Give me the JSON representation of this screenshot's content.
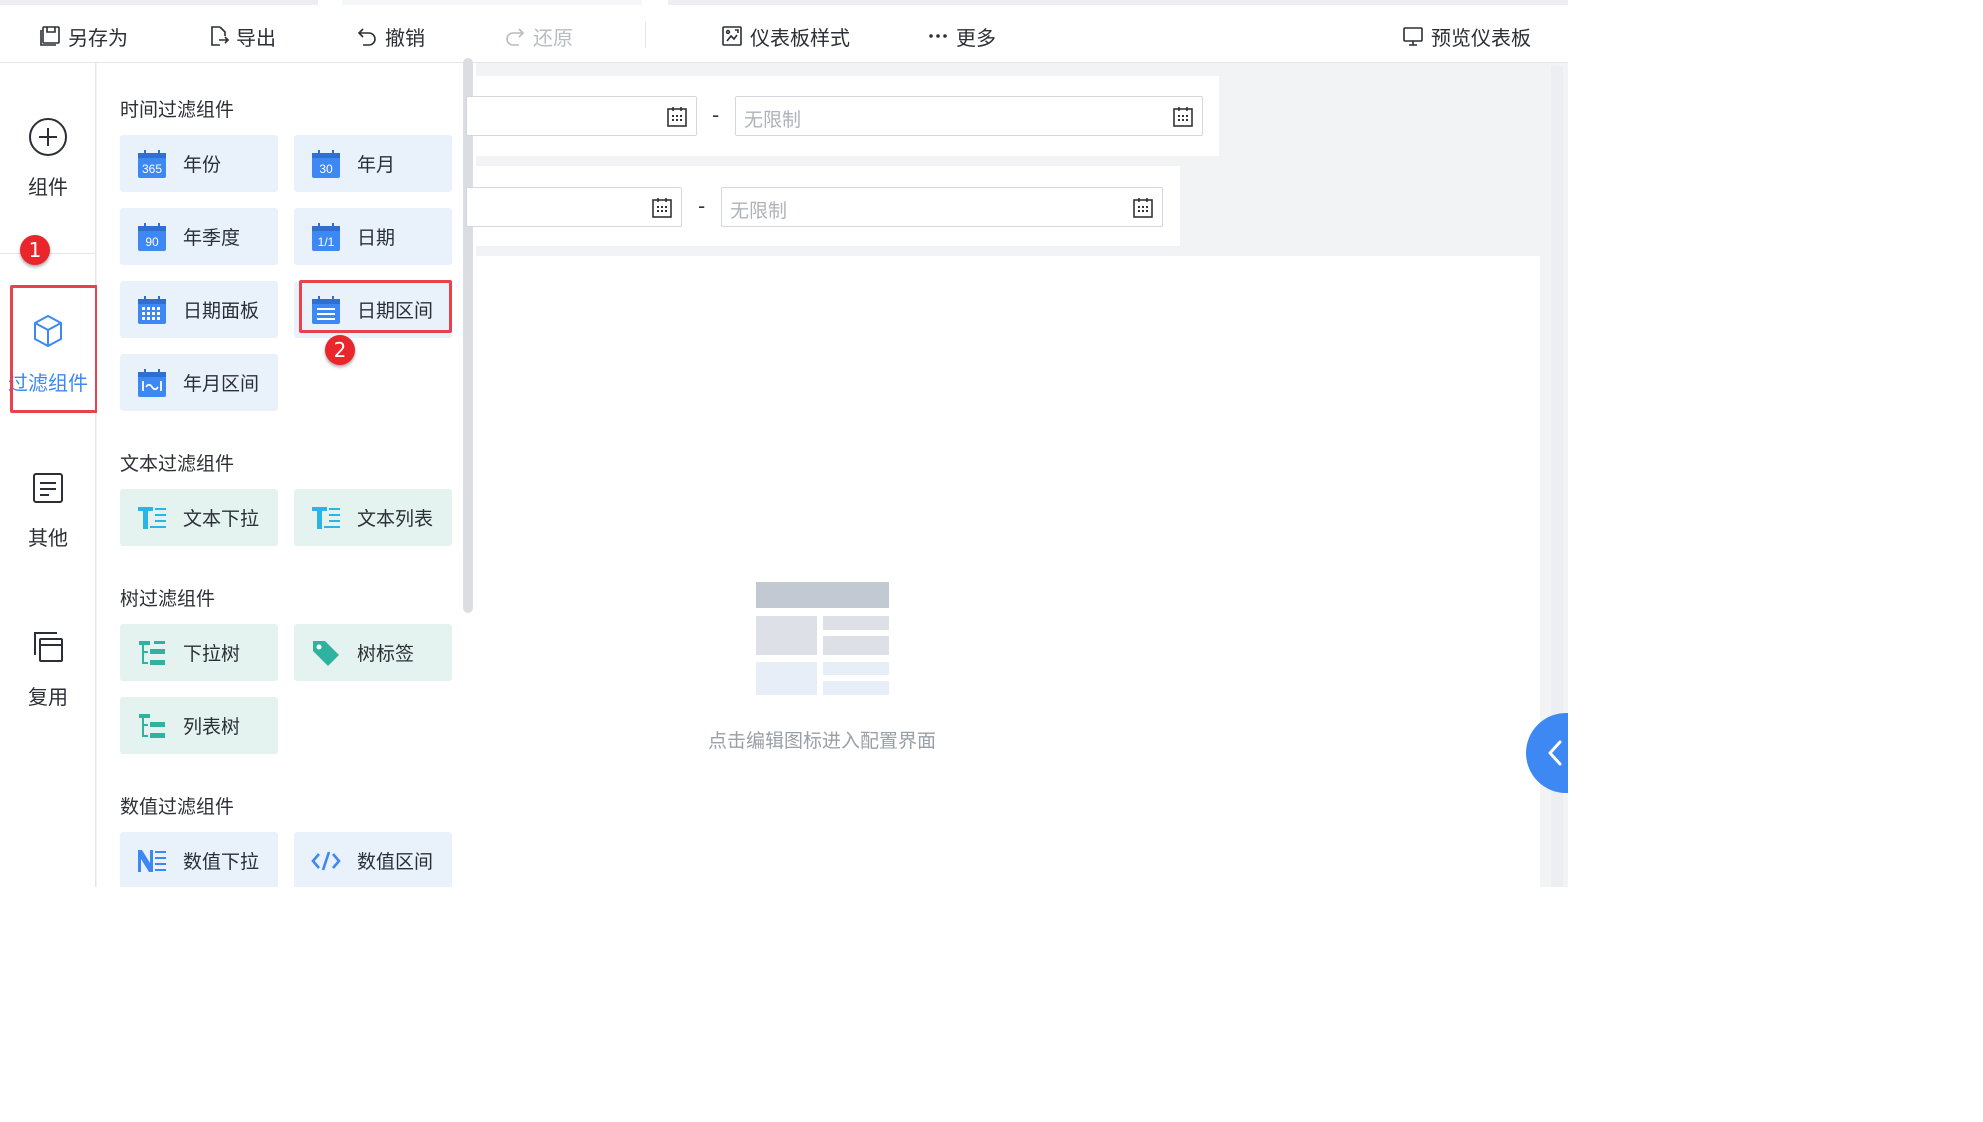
{
  "toolbar": {
    "save_as": "另存为",
    "export": "导出",
    "undo": "撤销",
    "redo": "还原",
    "dashboard_style": "仪表板样式",
    "more": "更多",
    "preview": "预览仪表板"
  },
  "rail": {
    "components": "组件",
    "filter_components": "过滤组件",
    "other": "其他",
    "reuse": "复用"
  },
  "annotations": {
    "step1": "1",
    "step2": "2"
  },
  "panel": {
    "time_section": "时间过滤组件",
    "time_items": [
      "年份",
      "年月",
      "年季度",
      "日期",
      "日期面板",
      "日期区间",
      "年月区间"
    ],
    "time_icon_labels": {
      "year": "365",
      "year_month": "30",
      "quarter": "90",
      "date": "1/1"
    },
    "text_section": "文本过滤组件",
    "text_items": [
      "文本下拉",
      "文本列表"
    ],
    "tree_section": "树过滤组件",
    "tree_items": [
      "下拉树",
      "树标签",
      "列表树"
    ],
    "number_section": "数值过滤组件",
    "number_items": [
      "数值下拉",
      "数值区间"
    ]
  },
  "canvas": {
    "range_separator": "-",
    "end_placeholder": "无限制",
    "empty_hint": "点击编辑图标进入配置界面"
  },
  "colors": {
    "accent": "#3d88f2",
    "highlight_border": "#e8434c",
    "badge": "#e8262c",
    "time_card_bg": "#e9f1fb",
    "tree_card_bg": "#e4f3ef",
    "teal_icon": "#2fb3a0",
    "cyan_icon": "#2bb5e5"
  }
}
